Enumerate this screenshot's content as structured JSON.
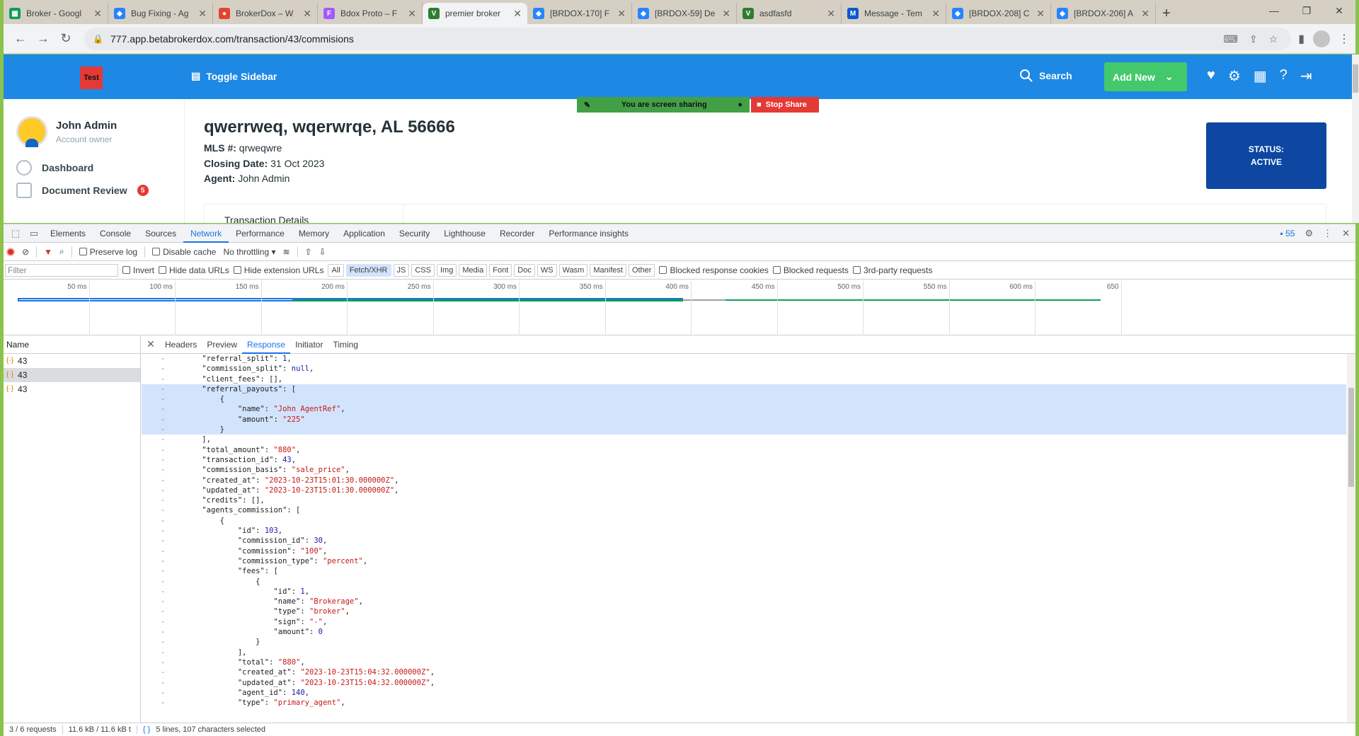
{
  "browser": {
    "tabs": [
      {
        "title": "Broker - Googl",
        "color": "#0f9d58",
        "glyph": "▦"
      },
      {
        "title": "Bug Fixing - Ag",
        "color": "#2684ff",
        "glyph": "◆"
      },
      {
        "title": "BrokerDox – W",
        "color": "#e2442f",
        "glyph": "●"
      },
      {
        "title": "Bdox Proto – F",
        "color": "#a259ff",
        "glyph": "F"
      },
      {
        "title": "premier broker",
        "color": "#2e7d32",
        "glyph": "V"
      },
      {
        "title": "[BRDOX-170] F",
        "color": "#2684ff",
        "glyph": "◆"
      },
      {
        "title": "[BRDOX-59] De",
        "color": "#2684ff",
        "glyph": "◆"
      },
      {
        "title": "asdfasfd",
        "color": "#2e7d32",
        "glyph": "V"
      },
      {
        "title": "Message - Tem",
        "color": "#0b57d0",
        "glyph": "M"
      },
      {
        "title": "[BRDOX-208] C",
        "color": "#2684ff",
        "glyph": "◆"
      },
      {
        "title": "[BRDOX-206] A",
        "color": "#2684ff",
        "glyph": "◆"
      }
    ],
    "url": "777.app.betabrokerdox.com/transaction/43/commisions"
  },
  "app": {
    "logo_text": "Test",
    "toggle_sidebar": "Toggle Sidebar",
    "search": "Search",
    "add_new": "Add New",
    "share_msg": "You are screen sharing",
    "stop_share": "Stop Share",
    "user_name": "John Admin",
    "user_role": "Account owner",
    "nav": {
      "dashboard": "Dashboard",
      "document_review": "Document Review",
      "document_review_badge": "5"
    },
    "address": "qwerrweq, wqerwrqe, AL 56666",
    "mls_label": "MLS #:",
    "mls": "qrweqwre",
    "closing_label": "Closing Date:",
    "closing": "31 Oct 2023",
    "agent_label": "Agent:",
    "agent": "John Admin",
    "status_label": "STATUS:",
    "status_value": "ACTIVE",
    "details_partial": "Transaction Details"
  },
  "devtools": {
    "tabs": [
      "Elements",
      "Console",
      "Sources",
      "Network",
      "Performance",
      "Memory",
      "Application",
      "Security",
      "Lighthouse",
      "Recorder",
      "Performance insights"
    ],
    "active_tab": "Network",
    "issues_count": "55",
    "toolbar": {
      "preserve_log": "Preserve log",
      "disable_cache": "Disable cache",
      "throttling": "No throttling"
    },
    "filter": {
      "placeholder": "Filter",
      "invert": "Invert",
      "hide_data": "Hide data URLs",
      "hide_ext": "Hide extension URLs",
      "types": [
        "All",
        "Fetch/XHR",
        "JS",
        "CSS",
        "Img",
        "Media",
        "Font",
        "Doc",
        "WS",
        "Wasm",
        "Manifest",
        "Other"
      ],
      "selected_type": "Fetch/XHR",
      "blocked_cookies": "Blocked response cookies",
      "blocked_requests": "Blocked requests",
      "third_party": "3rd-party requests"
    },
    "timeline_ticks": [
      "50 ms",
      "100 ms",
      "150 ms",
      "200 ms",
      "250 ms",
      "300 ms",
      "350 ms",
      "400 ms",
      "450 ms",
      "500 ms",
      "550 ms",
      "600 ms",
      "650"
    ],
    "name_header": "Name",
    "requests": [
      "43",
      "43",
      "43"
    ],
    "selected_request": 1,
    "detail_tabs": [
      "Headers",
      "Preview",
      "Response",
      "Initiator",
      "Timing"
    ],
    "active_detail_tab": "Response",
    "response_lines": [
      {
        "t": "    \"referral_split\": 1,",
        "hl": false
      },
      {
        "t": "    \"commission_split\": null,",
        "hl": false
      },
      {
        "t": "    \"client_fees\": [],",
        "hl": false
      },
      {
        "t": "    \"referral_payouts\": [",
        "hl": true
      },
      {
        "t": "        {",
        "hl": true
      },
      {
        "t": "            \"name\": \"John AgentRef\",",
        "hl": true
      },
      {
        "t": "            \"amount\": \"225\"",
        "hl": true
      },
      {
        "t": "        }",
        "hl": true
      },
      {
        "t": "    ],",
        "hl": false
      },
      {
        "t": "    \"total_amount\": \"880\",",
        "hl": false
      },
      {
        "t": "    \"transaction_id\": 43,",
        "hl": false
      },
      {
        "t": "    \"commission_basis\": \"sale_price\",",
        "hl": false
      },
      {
        "t": "    \"created_at\": \"2023-10-23T15:01:30.000000Z\",",
        "hl": false
      },
      {
        "t": "    \"updated_at\": \"2023-10-23T15:01:30.000000Z\",",
        "hl": false
      },
      {
        "t": "    \"credits\": [],",
        "hl": false
      },
      {
        "t": "    \"agents_commission\": [",
        "hl": false
      },
      {
        "t": "        {",
        "hl": false
      },
      {
        "t": "            \"id\": 103,",
        "hl": false
      },
      {
        "t": "            \"commission_id\": 30,",
        "hl": false
      },
      {
        "t": "            \"commission\": \"100\",",
        "hl": false
      },
      {
        "t": "            \"commission_type\": \"percent\",",
        "hl": false
      },
      {
        "t": "            \"fees\": [",
        "hl": false
      },
      {
        "t": "                {",
        "hl": false
      },
      {
        "t": "                    \"id\": 1,",
        "hl": false
      },
      {
        "t": "                    \"name\": \"Brokerage\",",
        "hl": false
      },
      {
        "t": "                    \"type\": \"broker\",",
        "hl": false
      },
      {
        "t": "                    \"sign\": \"-\",",
        "hl": false
      },
      {
        "t": "                    \"amount\": 0",
        "hl": false
      },
      {
        "t": "                }",
        "hl": false
      },
      {
        "t": "            ],",
        "hl": false
      },
      {
        "t": "            \"total\": \"880\",",
        "hl": false
      },
      {
        "t": "            \"created_at\": \"2023-10-23T15:04:32.000000Z\",",
        "hl": false
      },
      {
        "t": "            \"updated_at\": \"2023-10-23T15:04:32.000000Z\",",
        "hl": false
      },
      {
        "t": "            \"agent_id\": 140,",
        "hl": false
      },
      {
        "t": "            \"type\": \"primary_agent\",",
        "hl": false
      }
    ],
    "status": {
      "requests": "3 / 6 requests",
      "size": "11.6 kB / 11.6 kB t",
      "selection": "5 lines, 107 characters selected"
    }
  }
}
